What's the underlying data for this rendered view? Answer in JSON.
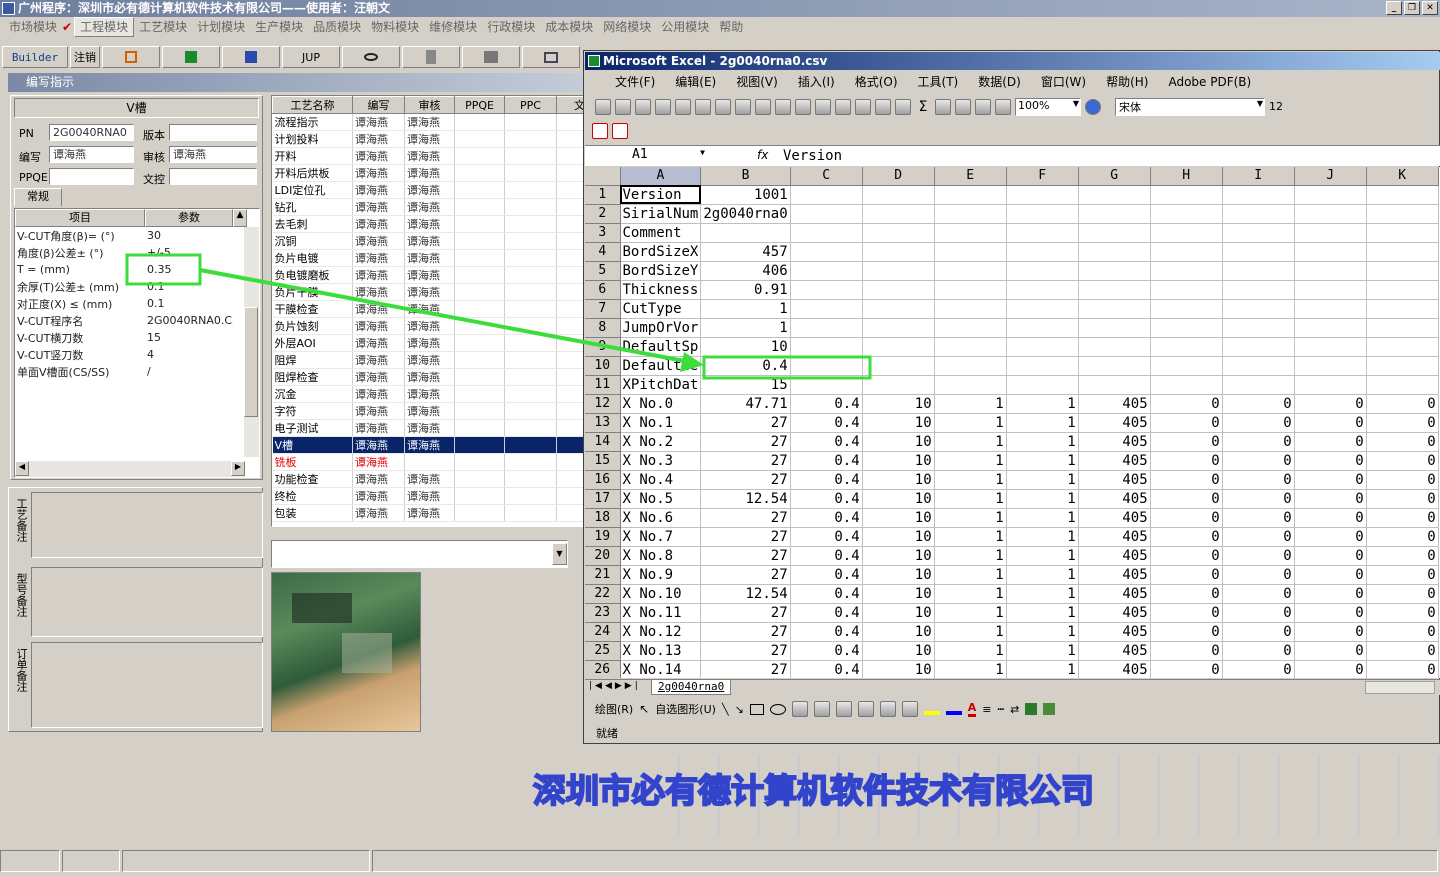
{
  "app_title": "广州程序：深圳市必有德计算机软件技术有限公司——使用者：汪朝文",
  "main_menu": [
    {
      "label": "市场模块",
      "active": false
    },
    {
      "label": "工程模块",
      "active": true
    },
    {
      "label": "工艺模块",
      "active": false
    },
    {
      "label": "计划模块",
      "active": false
    },
    {
      "label": "生产模块",
      "active": false
    },
    {
      "label": "品质模块",
      "active": false
    },
    {
      "label": "物料模块",
      "active": false
    },
    {
      "label": "维修模块",
      "active": false
    },
    {
      "label": "行政模块",
      "active": false
    },
    {
      "label": "成本模块",
      "active": false
    },
    {
      "label": "网络模块",
      "active": false
    },
    {
      "label": "公用模块",
      "active": false
    },
    {
      "label": "帮助",
      "active": false
    }
  ],
  "toolbar": {
    "builder": "Builder",
    "logout": "注销",
    "jup": "JUP"
  },
  "panel_title": "编写指示",
  "section_title": "V槽",
  "form": {
    "pn_label": "PN",
    "pn_value": "2G0040RNA0",
    "version_label": "版本",
    "version_value": "",
    "writer_label": "编写",
    "writer_value": "谭海燕",
    "reviewer_label": "审核",
    "reviewer_value": "谭海燕",
    "ppqe_label": "PPQE",
    "ppqe_value": "",
    "doc_label": "文控",
    "doc_value": ""
  },
  "tab_general": "常规",
  "param_headers": {
    "item": "项目",
    "param": "参数"
  },
  "params": [
    {
      "item": "V-CUT角度(β)=  (°)",
      "value": "30"
    },
    {
      "item": "角度(β)公差±  (°)",
      "value": "+/-5"
    },
    {
      "item": "T =  (mm)",
      "value": "0.35"
    },
    {
      "item": "余厚(T)公差±  (mm)",
      "value": "0.1"
    },
    {
      "item": "对正度(X) ≤  (mm)",
      "value": "0.1"
    },
    {
      "item": "V-CUT程序名",
      "value": "2G0040RNA0.CSV"
    },
    {
      "item": "V-CUT横刀数",
      "value": "15"
    },
    {
      "item": "V-CUT竖刀数",
      "value": "4"
    },
    {
      "item": "单面V槽面(CS/SS)",
      "value": "/"
    }
  ],
  "notes": {
    "process": "工艺备注",
    "model": "型号备注",
    "order": "订单备注"
  },
  "process_headers": [
    "工艺名称",
    "编写",
    "审核",
    "PPQE",
    "PPC",
    "文"
  ],
  "processes": [
    {
      "name": "流程指示",
      "w": "谭海燕",
      "r": "谭海燕",
      "state": "normal"
    },
    {
      "name": "计划投料",
      "w": "谭海燕",
      "r": "谭海燕",
      "state": "normal"
    },
    {
      "name": "开料",
      "w": "谭海燕",
      "r": "谭海燕",
      "state": "normal"
    },
    {
      "name": "开料后烘板",
      "w": "谭海燕",
      "r": "谭海燕",
      "state": "normal"
    },
    {
      "name": "LDI定位孔",
      "w": "谭海燕",
      "r": "谭海燕",
      "state": "normal"
    },
    {
      "name": "钻孔",
      "w": "谭海燕",
      "r": "谭海燕",
      "state": "normal"
    },
    {
      "name": "去毛刺",
      "w": "谭海燕",
      "r": "谭海燕",
      "state": "normal"
    },
    {
      "name": "沉铜",
      "w": "谭海燕",
      "r": "谭海燕",
      "state": "normal"
    },
    {
      "name": "负片电镀",
      "w": "谭海燕",
      "r": "谭海燕",
      "state": "normal"
    },
    {
      "name": "负电镀磨板",
      "w": "谭海燕",
      "r": "谭海燕",
      "state": "normal"
    },
    {
      "name": "负片干膜",
      "w": "谭海燕",
      "r": "谭海燕",
      "state": "normal"
    },
    {
      "name": "干膜检查",
      "w": "谭海燕",
      "r": "谭海燕",
      "state": "normal"
    },
    {
      "name": "负片蚀刻",
      "w": "谭海燕",
      "r": "谭海燕",
      "state": "normal"
    },
    {
      "name": "外层AOI",
      "w": "谭海燕",
      "r": "谭海燕",
      "state": "normal"
    },
    {
      "name": "阻焊",
      "w": "谭海燕",
      "r": "谭海燕",
      "state": "normal"
    },
    {
      "name": "阻焊检查",
      "w": "谭海燕",
      "r": "谭海燕",
      "state": "normal"
    },
    {
      "name": "沉金",
      "w": "谭海燕",
      "r": "谭海燕",
      "state": "normal"
    },
    {
      "name": "字符",
      "w": "谭海燕",
      "r": "谭海燕",
      "state": "normal"
    },
    {
      "name": "电子测试",
      "w": "谭海燕",
      "r": "谭海燕",
      "state": "normal"
    },
    {
      "name": "V槽",
      "w": "谭海燕",
      "r": "谭海燕",
      "state": "selected"
    },
    {
      "name": "铣板",
      "w": "谭海燕",
      "r": "",
      "state": "red"
    },
    {
      "name": "功能检查",
      "w": "谭海燕",
      "r": "谭海燕",
      "state": "normal"
    },
    {
      "name": "终检",
      "w": "谭海燕",
      "r": "谭海燕",
      "state": "normal"
    },
    {
      "name": "包装",
      "w": "谭海燕",
      "r": "谭海燕",
      "state": "normal"
    }
  ],
  "excel": {
    "title": "Microsoft Excel - 2g0040rna0.csv",
    "menu": [
      "文件(F)",
      "编辑(E)",
      "视图(V)",
      "插入(I)",
      "格式(O)",
      "工具(T)",
      "数据(D)",
      "窗口(W)",
      "帮助(H)",
      "Adobe PDF(B)"
    ],
    "zoom": "100%",
    "font": "宋体",
    "font_size": "12",
    "name_box": "A1",
    "fx": "fx",
    "formula": "Version",
    "columns": [
      "A",
      "B",
      "C",
      "D",
      "E",
      "F",
      "G",
      "H",
      "I",
      "J",
      "K"
    ],
    "rows": [
      [
        "1",
        "Version",
        "1001",
        "",
        "",
        "",
        "",
        "",
        "",
        "",
        "",
        ""
      ],
      [
        "2",
        "SirialNum",
        "2g0040rna0",
        "",
        "",
        "",
        "",
        "",
        "",
        "",
        "",
        ""
      ],
      [
        "3",
        "Comment",
        "",
        "",
        "",
        "",
        "",
        "",
        "",
        "",
        "",
        ""
      ],
      [
        "4",
        "BordSizeX",
        "457",
        "",
        "",
        "",
        "",
        "",
        "",
        "",
        "",
        ""
      ],
      [
        "5",
        "BordSizeY",
        "406",
        "",
        "",
        "",
        "",
        "",
        "",
        "",
        "",
        ""
      ],
      [
        "6",
        "Thickness",
        "0.91",
        "",
        "",
        "",
        "",
        "",
        "",
        "",
        "",
        ""
      ],
      [
        "7",
        "CutType",
        "1",
        "",
        "",
        "",
        "",
        "",
        "",
        "",
        "",
        ""
      ],
      [
        "8",
        "JumpOrVor",
        "1",
        "",
        "",
        "",
        "",
        "",
        "",
        "",
        "",
        ""
      ],
      [
        "9",
        "DefaultSp",
        "10",
        "",
        "",
        "",
        "",
        "",
        "",
        "",
        "",
        ""
      ],
      [
        "10",
        "DefaultWe",
        "0.4",
        "",
        "",
        "",
        "",
        "",
        "",
        "",
        "",
        ""
      ],
      [
        "11",
        "XPitchDat",
        "15",
        "",
        "",
        "",
        "",
        "",
        "",
        "",
        "",
        ""
      ],
      [
        "12",
        "X No.0",
        "47.71",
        "0.4",
        "10",
        "1",
        "1",
        "405",
        "0",
        "0",
        "0",
        "0"
      ],
      [
        "13",
        "X No.1",
        "27",
        "0.4",
        "10",
        "1",
        "1",
        "405",
        "0",
        "0",
        "0",
        "0"
      ],
      [
        "14",
        "X No.2",
        "27",
        "0.4",
        "10",
        "1",
        "1",
        "405",
        "0",
        "0",
        "0",
        "0"
      ],
      [
        "15",
        "X No.3",
        "27",
        "0.4",
        "10",
        "1",
        "1",
        "405",
        "0",
        "0",
        "0",
        "0"
      ],
      [
        "16",
        "X No.4",
        "27",
        "0.4",
        "10",
        "1",
        "1",
        "405",
        "0",
        "0",
        "0",
        "0"
      ],
      [
        "17",
        "X No.5",
        "12.54",
        "0.4",
        "10",
        "1",
        "1",
        "405",
        "0",
        "0",
        "0",
        "0"
      ],
      [
        "18",
        "X No.6",
        "27",
        "0.4",
        "10",
        "1",
        "1",
        "405",
        "0",
        "0",
        "0",
        "0"
      ],
      [
        "19",
        "X No.7",
        "27",
        "0.4",
        "10",
        "1",
        "1",
        "405",
        "0",
        "0",
        "0",
        "0"
      ],
      [
        "20",
        "X No.8",
        "27",
        "0.4",
        "10",
        "1",
        "1",
        "405",
        "0",
        "0",
        "0",
        "0"
      ],
      [
        "21",
        "X No.9",
        "27",
        "0.4",
        "10",
        "1",
        "1",
        "405",
        "0",
        "0",
        "0",
        "0"
      ],
      [
        "22",
        "X No.10",
        "12.54",
        "0.4",
        "10",
        "1",
        "1",
        "405",
        "0",
        "0",
        "0",
        "0"
      ],
      [
        "23",
        "X No.11",
        "27",
        "0.4",
        "10",
        "1",
        "1",
        "405",
        "0",
        "0",
        "0",
        "0"
      ],
      [
        "24",
        "X No.12",
        "27",
        "0.4",
        "10",
        "1",
        "1",
        "405",
        "0",
        "0",
        "0",
        "0"
      ],
      [
        "25",
        "X No.13",
        "27",
        "0.4",
        "10",
        "1",
        "1",
        "405",
        "0",
        "0",
        "0",
        "0"
      ],
      [
        "26",
        "X No.14",
        "27",
        "0.4",
        "10",
        "1",
        "1",
        "405",
        "0",
        "0",
        "0",
        "0"
      ]
    ],
    "sheet_tab": "2g0040rna0",
    "draw_label": "绘图(R)",
    "autoshape_label": "自选图形(U)",
    "status": "就绪"
  },
  "watermark": "深圳市必有德计算机软件技术有限公司",
  "colors": {
    "highlight_box": "#3ddc3d",
    "selected_row": "#0a246a",
    "red_text": "#e00000"
  }
}
